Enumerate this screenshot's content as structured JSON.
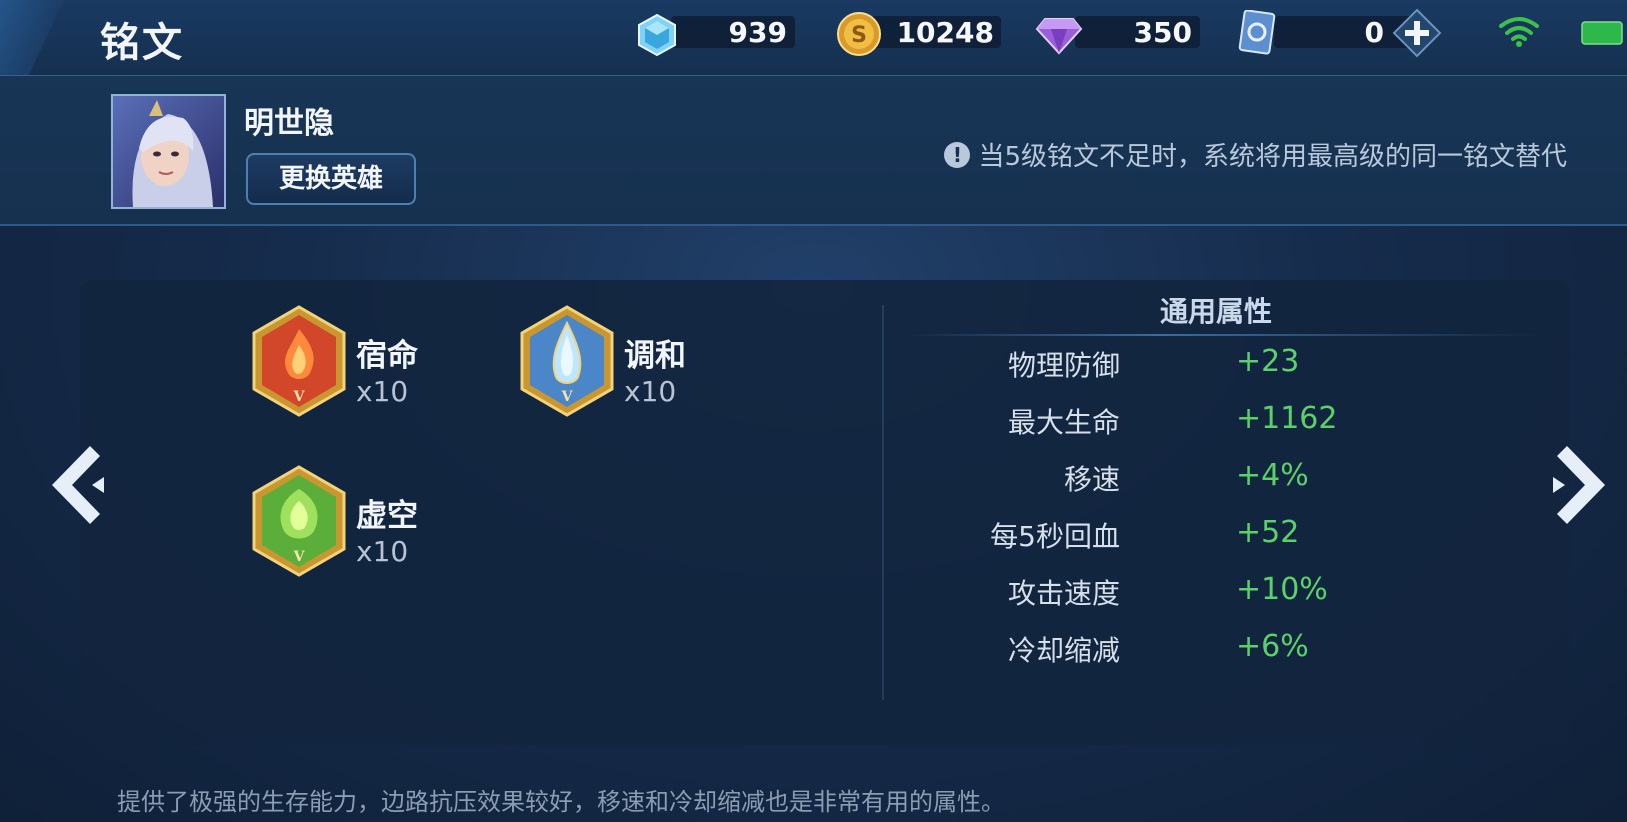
{
  "header": {
    "title": "铭文",
    "resources": [
      {
        "icon": "crystal-icon",
        "value": "939"
      },
      {
        "icon": "gold-coin-icon",
        "value": "10248"
      },
      {
        "icon": "diamond-icon",
        "value": "350"
      },
      {
        "icon": "voucher-icon",
        "value": "0"
      }
    ]
  },
  "hero": {
    "name": "明世隐",
    "change_button": "更换英雄"
  },
  "notice": "当5级铭文不足时，系统将用最高级的同一铭文替代",
  "runes": [
    {
      "name": "宿命",
      "count": "x10",
      "color": "#d2472a",
      "level": "V"
    },
    {
      "name": "调和",
      "count": "x10",
      "color": "#4a86c8",
      "level": "V"
    },
    {
      "name": "虚空",
      "count": "x10",
      "color": "#5cae3b",
      "level": "V"
    }
  ],
  "attributes": {
    "title": "通用属性",
    "rows": [
      {
        "label": "物理防御",
        "value": "+23"
      },
      {
        "label": "最大生命",
        "value": "+1162"
      },
      {
        "label": "移速",
        "value": "+4%"
      },
      {
        "label": "每5秒回血",
        "value": "+52"
      },
      {
        "label": "攻击速度",
        "value": "+10%"
      },
      {
        "label": "冷却缩减",
        "value": "+6%"
      }
    ]
  },
  "description": "提供了极强的生存能力，边路抗压效果较好，移速和冷却缩减也是非常有用的属性。",
  "colors": {
    "accent_green": "#5bd16a",
    "wifi": "#3cc24a",
    "battery": "#2fb84a"
  }
}
